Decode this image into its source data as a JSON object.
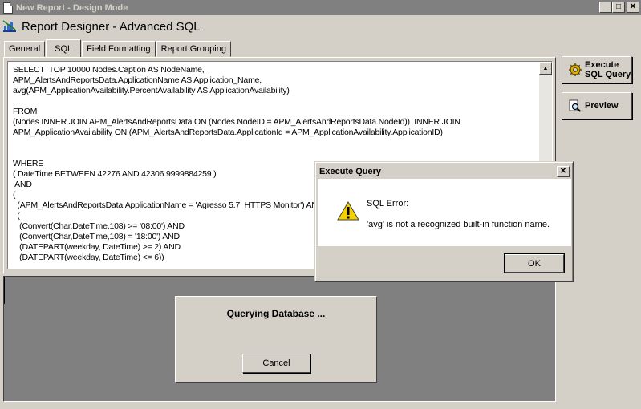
{
  "window": {
    "title": "New Report - Design Mode",
    "controls": {
      "minimize": "_",
      "maximize": "□",
      "close": "✕"
    }
  },
  "header": {
    "title": "Report Designer - Advanced SQL"
  },
  "tabs": [
    {
      "label": "General"
    },
    {
      "label": "SQL",
      "active": true
    },
    {
      "label": "Field Formatting"
    },
    {
      "label": "Report Grouping"
    }
  ],
  "editor": {
    "sql": "SELECT  TOP 10000 Nodes.Caption AS NodeName,\nAPM_AlertsAndReportsData.ApplicationName AS Application_Name,\navg(APM_ApplicationAvailability.PercentAvailability AS ApplicationAvailability)\n\nFROM\n(Nodes INNER JOIN APM_AlertsAndReportsData ON (Nodes.NodeID = APM_AlertsAndReportsData.NodeId))  INNER JOIN\nAPM_ApplicationAvailability ON (APM_AlertsAndReportsData.ApplicationId = APM_ApplicationAvailability.ApplicationID)\n\n\nWHERE\n( DateTime BETWEEN 42276 AND 42306.9999884259 )\n AND\n(\n  (APM_AlertsAndReportsData.ApplicationName = 'Agresso 5.7  HTTPS Monitor') AND\n  (\n   (Convert(Char,DateTime,108) >= '08:00') AND\n   (Convert(Char,DateTime,108) = '18:00') AND\n   (DATEPART(weekday, DateTime) >= 2) AND\n   (DATEPART(weekday, DateTime) <= 6))"
  },
  "buttons": {
    "execute_sql": "Execute\nSQL Query",
    "preview": "Preview"
  },
  "progress": {
    "message": "Querying Database ...",
    "cancel": "Cancel"
  },
  "dialog": {
    "title": "Execute Query",
    "heading": "SQL Error:",
    "message": "'avg' is not a recognized built-in function name.",
    "ok": "OK"
  },
  "icons": {
    "app": "document-icon",
    "designer": "report-designer-icon",
    "execute": "gear-icon",
    "preview": "magnifier-document-icon",
    "warning": "warning-icon"
  },
  "colors": {
    "face": "#d4d0c8",
    "inactive_title": "#808080",
    "warning": "#f5d000"
  }
}
